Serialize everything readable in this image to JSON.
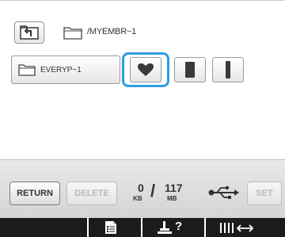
{
  "header": {
    "path": "/MYEMBR~1",
    "up_icon": "folder-up-icon",
    "folder_icon": "folder-icon"
  },
  "folders": [
    {
      "label": "EVERYP~1",
      "icon": "folder-icon"
    }
  ],
  "shapes": [
    {
      "name": "heart",
      "icon": "heart-icon",
      "selected": true
    },
    {
      "name": "rectangle",
      "icon": "rectangle-icon",
      "selected": false
    },
    {
      "name": "bar",
      "icon": "vertical-bar-icon",
      "selected": false
    }
  ],
  "toolbar": {
    "return_label": "RETURN",
    "delete_label": "DELETE",
    "set_label": "SET",
    "memory_used": "0",
    "memory_used_unit": "KB",
    "memory_total": "117",
    "memory_total_unit": "MB",
    "usb_icon": "usb-icon"
  },
  "tabs": {
    "help_label": "?",
    "items": [
      "settings-list-icon",
      "help-machine-icon",
      "thread-tension-icon"
    ]
  },
  "colors": {
    "selection": "#2f9de0",
    "tabbar": "#1b1b1b",
    "disabled_text": "#b9b9b9"
  }
}
